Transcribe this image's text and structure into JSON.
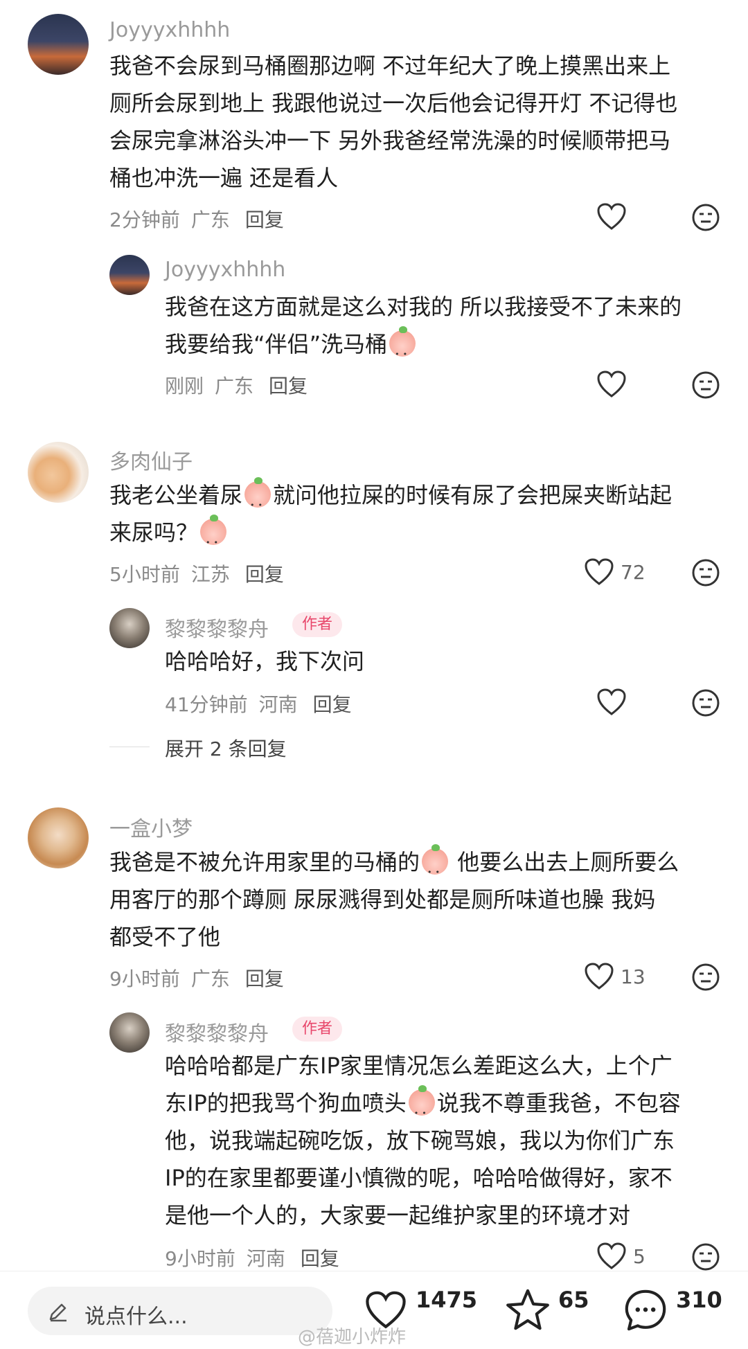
{
  "comments": [
    {
      "username": "Joyyyxhhhh",
      "lines": [
        "我爸不会尿到马桶圈那边啊 不过年纪大了晚上摸黑出来上",
        "厕所会尿到地上 我跟他说过一次后他会记得开灯 不记得也",
        "会尿完拿淋浴头冲一下 另外我爸经常洗澡的时候顺带把马",
        "桶也冲洗一遍 还是看人"
      ],
      "time": "2分钟前",
      "location": "广东",
      "reply": "回复",
      "likes": ""
    },
    {
      "username": "Joyyyxhhhh",
      "line1": "我爸在这方面就是这么对我的 所以我接受不了未来的",
      "line2": "我要给我“伴侣”洗马桶",
      "time": "刚刚",
      "location": "广东",
      "reply": "回复",
      "likes": ""
    },
    {
      "username": "多肉仙子",
      "line1a": "我老公坐着尿",
      "line1b": "就问他拉屎的时候有尿了会把屎夹断站起",
      "line2": "来尿吗？",
      "time": "5小时前",
      "location": "江苏",
      "reply": "回复",
      "likes": "72"
    },
    {
      "username": "黎黎黎黎舟",
      "tag": "作者",
      "line1": "哈哈哈好，我下次问",
      "time": "41分钟前",
      "location": "河南",
      "reply": "回复",
      "likes": "",
      "expand": "展开 2 条回复"
    },
    {
      "username": "一盒小梦",
      "line1a": "我爸是不被允许用家里的马桶的",
      "line1b": " 他要么出去上厕所要么",
      "line2": "用客厅的那个蹲厕  尿尿溅得到处都是厕所味道也臊  我妈",
      "line3": "都受不了他",
      "time": "9小时前",
      "location": "广东",
      "reply": "回复",
      "likes": "13"
    },
    {
      "username": "黎黎黎黎舟",
      "tag": "作者",
      "line1": "哈哈哈都是广东IP家里情况怎么差距这么大，上个广",
      "line2a": "东IP的把我骂个狗血喷头",
      "line2b": "说我不尊重我爸，不包容",
      "line3": "他，说我端起碗吃饭，放下碗骂娘，我以为你们广东",
      "line4": "IP的在家里都要谨小慎微的呢，哈哈哈做得好，家不",
      "line5": "是他一个人的，大家要一起维护家里的环境才对",
      "time": "9小时前",
      "location": "河南",
      "reply": "回复",
      "likes": "5"
    }
  ],
  "bottom_bar": {
    "placeholder": "说点什么...",
    "likes": "1475",
    "stars": "65",
    "comments": "310"
  },
  "watermark": "@蓓迦小炸炸",
  "icons": [
    "heart-icon",
    "meh-face-icon",
    "pencil-icon",
    "star-icon",
    "chat-bubble-icon"
  ],
  "colors": {
    "author_tag_bg": "#fde8ec",
    "author_tag_text": "#e8476b",
    "meta": "#8a8a8a"
  }
}
